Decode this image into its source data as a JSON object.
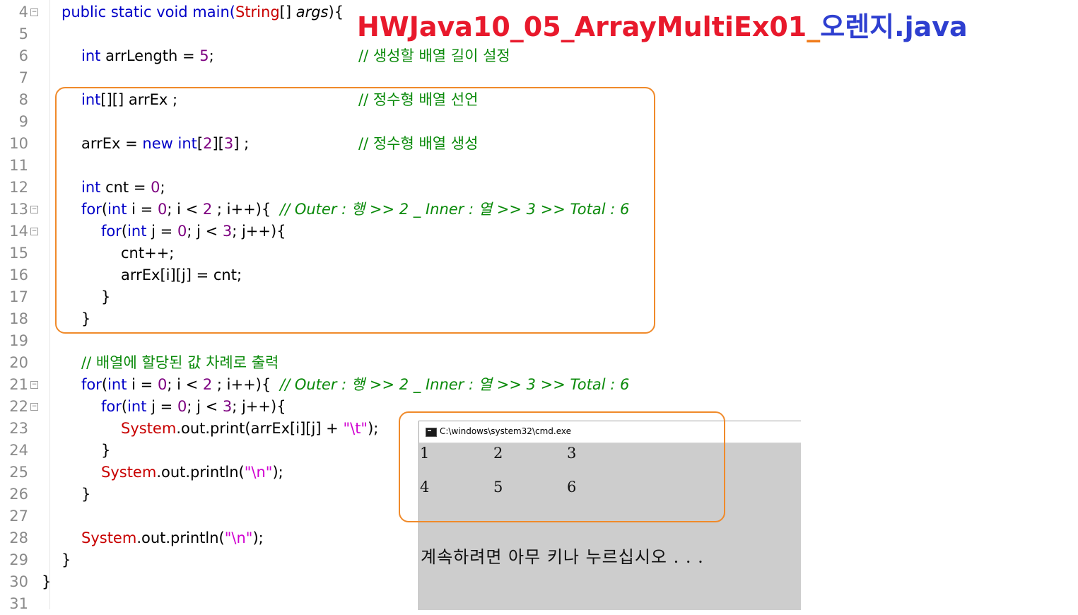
{
  "title": {
    "part1": "HWJava10_05_ArrayMultiEx01",
    "part2": "_",
    "part3": "오렌지.java"
  },
  "line_numbers": [
    "4",
    "5",
    "6",
    "7",
    "8",
    "9",
    "10",
    "11",
    "12",
    "13",
    "14",
    "15",
    "16",
    "17",
    "18",
    "19",
    "20",
    "21",
    "22",
    "23",
    "24",
    "25",
    "26",
    "27",
    "28",
    "29",
    "30",
    "31"
  ],
  "code": {
    "l4": {
      "a": "public static void main(",
      "b": "String",
      "c": "[] ",
      "d": "args",
      "e": "){"
    },
    "l6": {
      "a": "int",
      "b": " arrLength = ",
      "c": "5",
      "d": ";"
    },
    "l6_comment": "// 생성할 배열 길이 설정",
    "l8": {
      "a": "int",
      "b": "[][] arrEx ;"
    },
    "l8_comment": "// 정수형 배열 선언",
    "l10": {
      "a": "arrEx = ",
      "b": "new",
      "c": " ",
      "d": "int",
      "e": "[",
      "f": "2",
      "g": "][",
      "h": "3",
      "i": "] ;"
    },
    "l10_comment": "// 정수형 배열 생성",
    "l12": {
      "a": "int",
      "b": " cnt = ",
      "c": "0",
      "d": ";"
    },
    "l13": {
      "a": "for",
      "b": "(",
      "c": "int",
      "d": " i = ",
      "e": "0",
      "f": "; i < ",
      "g": "2",
      "h": " ; i++){"
    },
    "l13_comment": "// Outer : 행 >> 2 _ Inner : 열 >> 3 >> Total : 6",
    "l14": {
      "a": "for",
      "b": "(",
      "c": "int",
      "d": " j = ",
      "e": "0",
      "f": "; j < ",
      "g": "3",
      "h": "; j++){"
    },
    "l15": "cnt++;",
    "l16": "arrEx[i][j] = cnt;",
    "l17": "}",
    "l18": "}",
    "l20_comment": "// 배열에 할당된 값 차례로 출력",
    "l21": {
      "a": "for",
      "b": "(",
      "c": "int",
      "d": " i = ",
      "e": "0",
      "f": "; i < ",
      "g": "2",
      "h": " ; i++){"
    },
    "l21_comment": "// Outer : 행 >> 2 _ Inner : 열 >> 3 >> Total : 6",
    "l22": {
      "a": "for",
      "b": "(",
      "c": "int",
      "d": " j = ",
      "e": "0",
      "f": "; j < ",
      "g": "3",
      "h": "; j++){"
    },
    "l23": {
      "a": "System",
      "b": ".out.print(arrEx[i][j] + ",
      "c": "\"\\t\"",
      "d": ");"
    },
    "l24": "}",
    "l25": {
      "a": "System",
      "b": ".out.println(",
      "c": "\"\\n\"",
      "d": ");"
    },
    "l26": "}",
    "l28": {
      "a": "System",
      "b": ".out.println(",
      "c": "\"\\n\"",
      "d": ");"
    },
    "l29": "}",
    "l30": "}"
  },
  "console": {
    "title": "C:\\windows\\system32\\cmd.exe",
    "row1": [
      "1",
      "2",
      "3"
    ],
    "row2": [
      "4",
      "5",
      "6"
    ],
    "pause_message": "계속하려면 아무 키나 누르십시오 . . ."
  },
  "colors": {
    "keyword": "#0000c8",
    "type": "#c80000",
    "number": "#7d0080",
    "string": "#d000d0",
    "comment": "#0a8a0a",
    "highlight_box": "#f08a2a",
    "title_red": "#e8192c",
    "title_orange": "#f07b1a",
    "title_blue": "#2e3fd0",
    "console_bg": "#cdcdcd"
  }
}
